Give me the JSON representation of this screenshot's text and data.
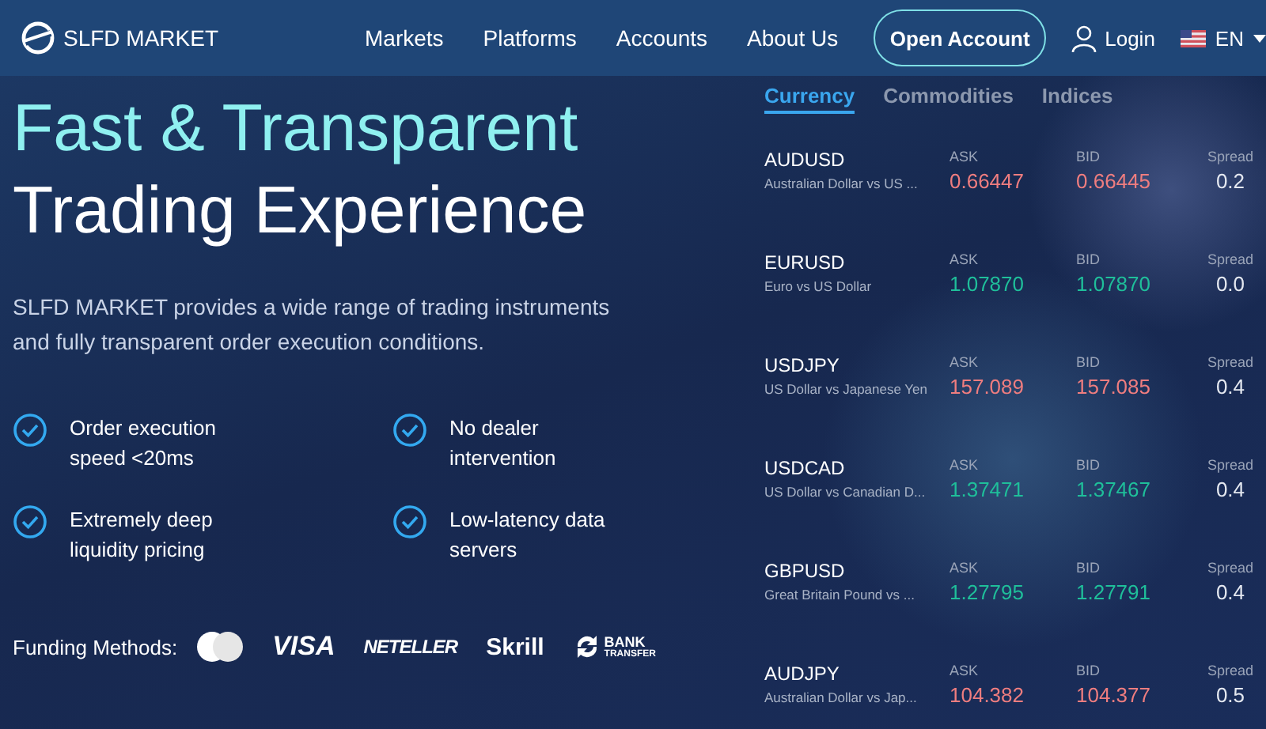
{
  "header": {
    "logo": "SLFD MARKET",
    "nav": [
      {
        "label": "Markets"
      },
      {
        "label": "Platforms"
      },
      {
        "label": "Accounts"
      },
      {
        "label": "About Us"
      }
    ],
    "cta": "Open Account",
    "login": "Login",
    "language": "EN"
  },
  "hero": {
    "title_line_1": "Fast & Transparent",
    "title_line_2": "Trading Experience",
    "description": "SLFD MARKET provides a wide range of trading instruments and fully transparent order execution conditions.",
    "features": [
      {
        "text": "Order execution speed <20ms"
      },
      {
        "text": "No dealer intervention"
      },
      {
        "text": "Extremely deep liquidity pricing"
      },
      {
        "text": "Low-latency data servers"
      }
    ],
    "funding": {
      "label": "Funding Methods:",
      "methods": [
        {
          "kind": "card"
        },
        {
          "kind": "visa",
          "text": "VISA"
        },
        {
          "kind": "neteller",
          "text": "NETELLER"
        },
        {
          "kind": "skrill",
          "text": "Skrill"
        },
        {
          "kind": "bank",
          "text": "BANK",
          "subtext": "TRANSFER"
        }
      ]
    }
  },
  "market": {
    "tabs": [
      {
        "label": "Currency",
        "selected": true
      },
      {
        "label": "Commodities",
        "selected": false
      },
      {
        "label": "Indices",
        "selected": false
      }
    ],
    "quotes": [
      {
        "symbol": "AUDUSD",
        "name": "Australian Dollar vs US ...",
        "ask_label": "ASK",
        "ask": "0.66447",
        "bid_label": "BID",
        "bid": "0.66445",
        "spread_label": "Spread",
        "spread": "0.2",
        "color": "#ef7d7f"
      },
      {
        "symbol": "EURUSD",
        "name": "Euro vs US Dollar",
        "ask_label": "ASK",
        "ask": "1.07870",
        "bid_label": "BID",
        "bid": "1.07870",
        "spread_label": "Spread",
        "spread": "0.0",
        "color": "#1fbf9a"
      },
      {
        "symbol": "USDJPY",
        "name": "US Dollar vs Japanese Yen",
        "ask_label": "ASK",
        "ask": "157.089",
        "bid_label": "BID",
        "bid": "157.085",
        "spread_label": "Spread",
        "spread": "0.4",
        "color": "#ef7d7f"
      },
      {
        "symbol": "USDCAD",
        "name": "US Dollar vs Canadian D...",
        "ask_label": "ASK",
        "ask": "1.37471",
        "bid_label": "BID",
        "bid": "1.37467",
        "spread_label": "Spread",
        "spread": "0.4",
        "color": "#1fbf9a"
      },
      {
        "symbol": "GBPUSD",
        "name": "Great Britain Pound vs ...",
        "ask_label": "ASK",
        "ask": "1.27795",
        "bid_label": "BID",
        "bid": "1.27791",
        "spread_label": "Spread",
        "spread": "0.4",
        "color": "#1fbf9a"
      },
      {
        "symbol": "AUDJPY",
        "name": "Australian Dollar vs Jap...",
        "ask_label": "ASK",
        "ask": "104.382",
        "bid_label": "BID",
        "bid": "104.377",
        "spread_label": "Spread",
        "spread": "0.5",
        "color": "#ef7d7f"
      }
    ]
  }
}
